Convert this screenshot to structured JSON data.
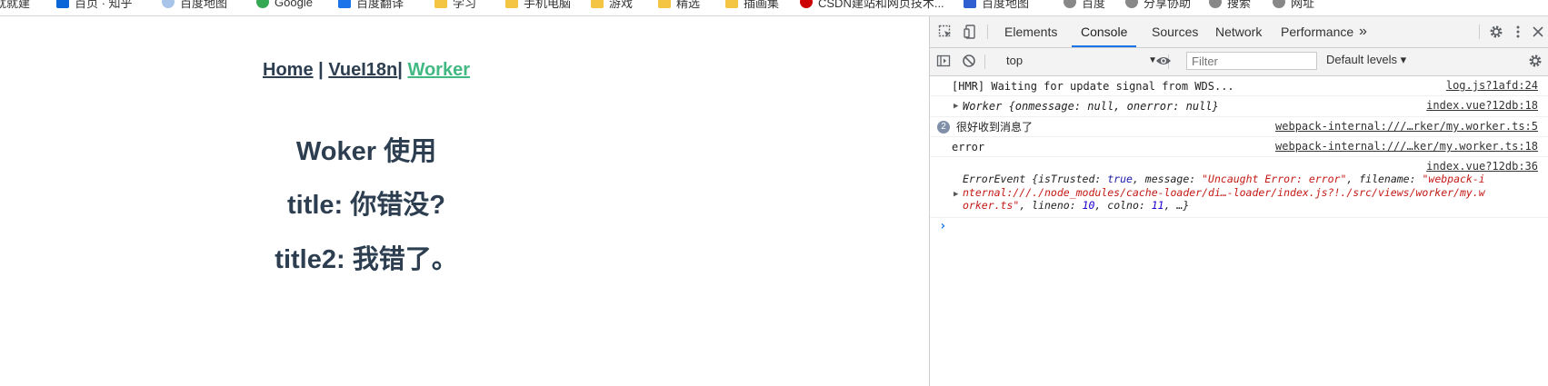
{
  "bookmarks": [
    {
      "label": "就就建"
    },
    {
      "label": "百页 · 知乎"
    },
    {
      "label": "百度地图"
    },
    {
      "label": "Google"
    },
    {
      "label": "百度翻译"
    },
    {
      "label": "学习"
    },
    {
      "label": "手机电脑"
    },
    {
      "label": "游戏"
    },
    {
      "label": "精选"
    },
    {
      "label": "插画集"
    },
    {
      "label": "CSDN建站和网页技术..."
    },
    {
      "label": "百度地图"
    },
    {
      "label": "百度"
    },
    {
      "label": "分享协助"
    },
    {
      "label": "搜索"
    },
    {
      "label": "网址"
    }
  ],
  "page": {
    "nav": {
      "home": "Home",
      "sep1": " | ",
      "vuei18n": "VueI18n",
      "sep2": "| ",
      "worker": "Worker"
    },
    "heading": "Woker 使用",
    "title1": "title: 你错没?",
    "title2": "title2: 我错了。"
  },
  "devtools": {
    "tabs": [
      "Elements",
      "Console",
      "Sources",
      "Network",
      "Performance"
    ],
    "active_tab": "Console",
    "more": "»",
    "context": "top",
    "filter_placeholder": "Filter",
    "levels": "Default levels ▾",
    "console": {
      "row1_msg": "[HMR] Waiting for update signal from WDS...",
      "row1_src": "log.js?1afd:24",
      "row2_msg": "Worker {onmessage: null, onerror: null}",
      "row2_src": "index.vue?12db:18",
      "row3_count": "2",
      "row3_msg": "很好收到消息了",
      "row3_src": "webpack-internal:///…rker/my.worker.ts:5",
      "row4_msg": "error",
      "row4_src": "webpack-internal:///…ker/my.worker.ts:18",
      "row5_src": "index.vue?12db:36",
      "row5_a": "ErrorEvent {isTrusted: ",
      "row5_true": "true",
      "row5_b": ", message: ",
      "row5_msgstr": "\"Uncaught Error: error\"",
      "row5_c": ", filename: ",
      "row5_file1": "\"webpack-i",
      "row5_file2": "nternal:///./node_modules/cache-loader/di…-loader/index.js?!./src/views/worker/my.w",
      "row5_file3": "orker.ts\"",
      "row5_d": ", lineno: ",
      "row5_lineno": "10",
      "row5_e": ", colno: ",
      "row5_colno": "11",
      "row5_f": ", …}",
      "prompt": "›"
    }
  },
  "colors": {
    "link": "#2c3e50",
    "active_link": "#42b983",
    "accent": "#1a73e8"
  }
}
